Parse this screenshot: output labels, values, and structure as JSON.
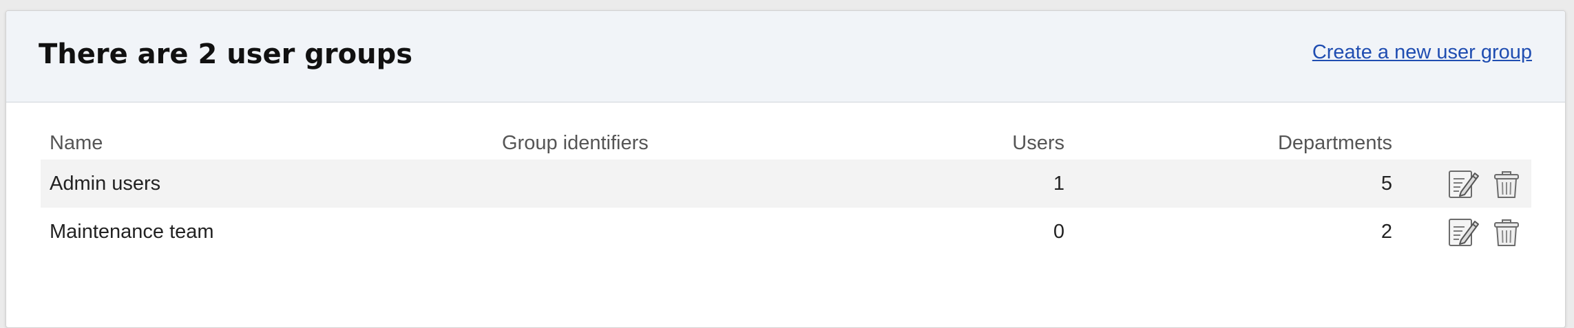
{
  "header": {
    "title": "There are 2 user groups",
    "create_link": "Create a new user group"
  },
  "table": {
    "columns": {
      "name": "Name",
      "identifiers": "Group identifiers",
      "users": "Users",
      "departments": "Departments"
    },
    "rows": [
      {
        "name": "Admin users",
        "identifiers": "",
        "users": "1",
        "departments": "5"
      },
      {
        "name": "Maintenance team",
        "identifiers": "",
        "users": "0",
        "departments": "2"
      }
    ]
  },
  "icons": {
    "edit": "edit-icon",
    "delete": "trash-icon"
  },
  "colors": {
    "link": "#1f4db1",
    "header_bg": "#f1f4f8",
    "row_alt_bg": "#f3f3f3"
  }
}
